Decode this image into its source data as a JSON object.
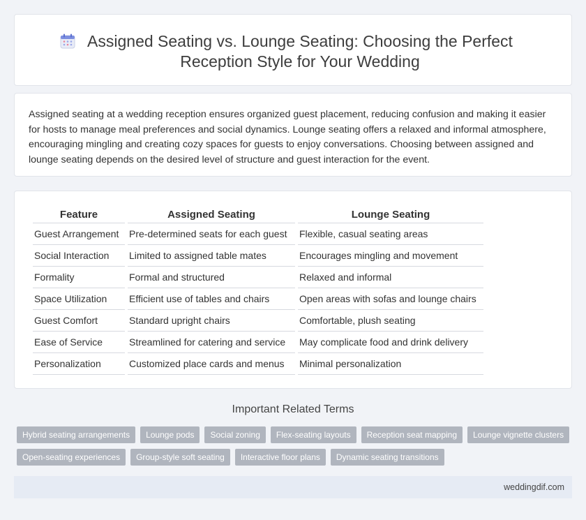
{
  "header": {
    "title": "Assigned Seating vs. Lounge Seating: Choosing the Perfect Reception Style for Your Wedding",
    "icon": "calendar-icon"
  },
  "intro": {
    "text": "Assigned seating at a wedding reception ensures organized guest placement, reducing confusion and making it easier for hosts to manage meal preferences and social dynamics. Lounge seating offers a relaxed and informal atmosphere, encouraging mingling and creating cozy spaces for guests to enjoy conversations. Choosing between assigned and lounge seating depends on the desired level of structure and guest interaction for the event."
  },
  "table": {
    "headers": [
      "Feature",
      "Assigned Seating",
      "Lounge Seating"
    ],
    "rows": [
      [
        "Guest Arrangement",
        "Pre-determined seats for each guest",
        "Flexible, casual seating areas"
      ],
      [
        "Social Interaction",
        "Limited to assigned table mates",
        "Encourages mingling and movement"
      ],
      [
        "Formality",
        "Formal and structured",
        "Relaxed and informal"
      ],
      [
        "Space Utilization",
        "Efficient use of tables and chairs",
        "Open areas with sofas and lounge chairs"
      ],
      [
        "Guest Comfort",
        "Standard upright chairs",
        "Comfortable, plush seating"
      ],
      [
        "Ease of Service",
        "Streamlined for catering and service",
        "May complicate food and drink delivery"
      ],
      [
        "Personalization",
        "Customized place cards and menus",
        "Minimal personalization"
      ]
    ]
  },
  "related": {
    "title": "Important Related Terms",
    "tags": [
      "Hybrid seating arrangements",
      "Lounge pods",
      "Social zoning",
      "Flex-seating layouts",
      "Reception seat mapping",
      "Lounge vignette clusters",
      "Open-seating experiences",
      "Group-style soft seating",
      "Interactive floor plans",
      "Dynamic seating transitions"
    ]
  },
  "footer": {
    "site": "weddingdif.com"
  }
}
